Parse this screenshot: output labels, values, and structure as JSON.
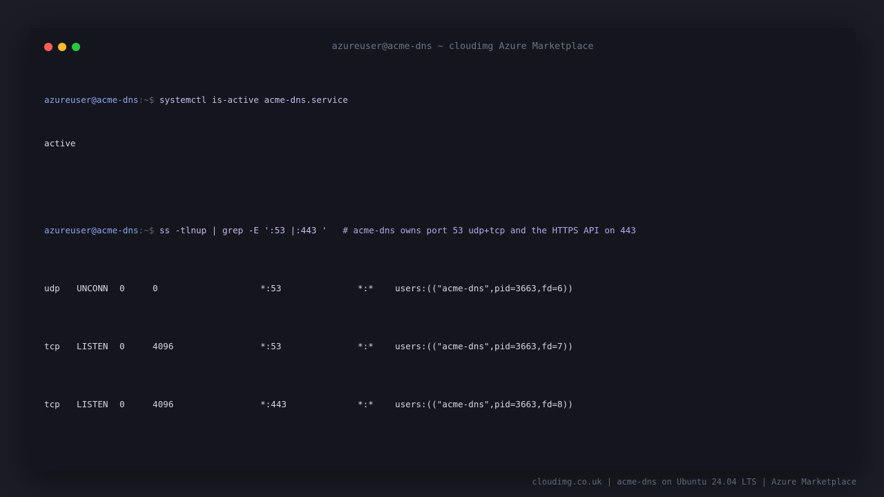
{
  "window": {
    "title": "azureuser@acme-dns ~ cloudimg Azure Marketplace",
    "controls": {
      "close_color": "#ff5f57",
      "minimize_color": "#febc2e",
      "maximize_color": "#28c840"
    }
  },
  "colors": {
    "background": "#1b1c24",
    "terminal_bg": "#15161d",
    "prompt_user": "#8aa4f0",
    "command": "#c9b8f3",
    "output": "#d3d7e1"
  },
  "terminal": {
    "cmd1": {
      "prompt_user": "azureuser@acme-dns",
      "prompt_path": ":~$",
      "command": "systemctl is-active acme-dns.service",
      "output": "active"
    },
    "cmd2": {
      "prompt_user": "azureuser@acme-dns",
      "prompt_path": ":~$",
      "command": "ss -tlnup | grep -E ':53 |:443 '",
      "comment": "# acme-dns owns port 53 udp+tcp and the HTTPS API on 443"
    },
    "sockets": [
      {
        "proto": "udp",
        "state": "UNCONN",
        "recv_q": "0",
        "send_q": "0",
        "local": "*:53",
        "peer": "*:*",
        "process": "users:((\"acme-dns\",pid=3663,fd=6))"
      },
      {
        "proto": "tcp",
        "state": "LISTEN",
        "recv_q": "0",
        "send_q": "4096",
        "local": "*:53",
        "peer": "*:*",
        "process": "users:((\"acme-dns\",pid=3663,fd=7))"
      },
      {
        "proto": "tcp",
        "state": "LISTEN",
        "recv_q": "0",
        "send_q": "4096",
        "local": "*:443",
        "peer": "*:*",
        "process": "users:((\"acme-dns\",pid=3663,fd=8))"
      }
    ]
  },
  "footer": {
    "text": "cloudimg.co.uk | acme-dns on Ubuntu 24.04 LTS | Azure Marketplace"
  }
}
